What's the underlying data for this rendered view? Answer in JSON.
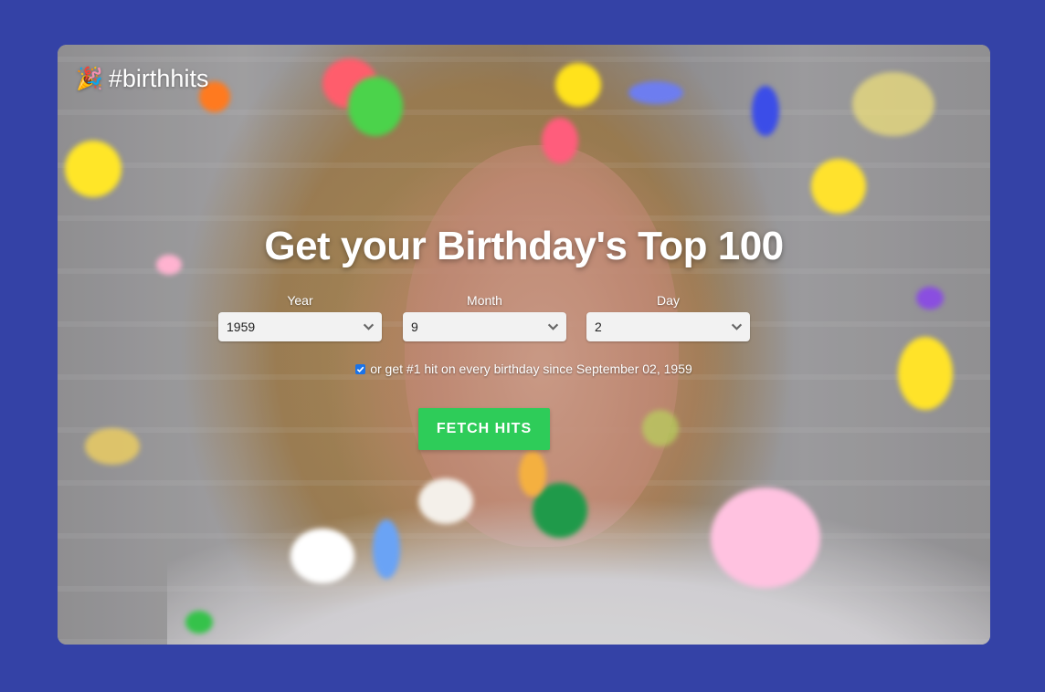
{
  "app": {
    "brand": "#birthhits",
    "brand_icon": "party-popper-icon",
    "background_color": "#3442a6"
  },
  "hero": {
    "title": "Get your Birthday's Top 100"
  },
  "form": {
    "year": {
      "label": "Year",
      "value": "1959"
    },
    "month": {
      "label": "Month",
      "value": "9"
    },
    "day": {
      "label": "Day",
      "value": "2"
    },
    "every_birthday": {
      "checked": true,
      "label": "or get #1 hit on every birthday since September 02, 1959"
    },
    "submit_label": "FETCH HITS",
    "submit_color": "#2ecc59"
  }
}
